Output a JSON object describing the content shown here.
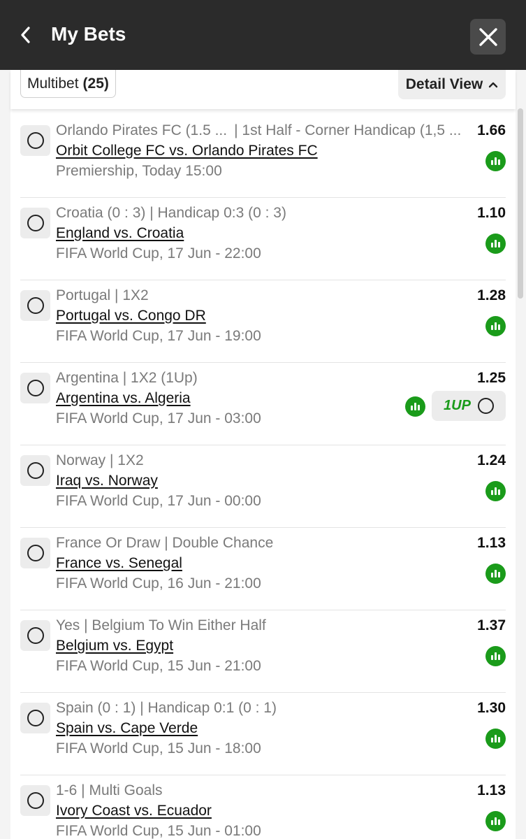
{
  "header": {
    "title": "My Bets"
  },
  "tabs": {
    "multibet_label": "Multibet",
    "multibet_count": "(25)",
    "detail_view_label": "Detail View"
  },
  "bets": [
    {
      "selection_left": "Orlando Pirates FC (1.5 ...",
      "selection_right": "| 1st Half - Corner Handicap (1,5 ...",
      "match": "Orbit College FC vs. Orlando Pirates FC",
      "info": "Premiership, Today 15:00",
      "odds": "1.66"
    },
    {
      "selection": "Croatia (0 : 3) | Handicap 0:3 (0 : 3)",
      "match": "England vs. Croatia",
      "info": "FIFA World Cup, 17 Jun - 22:00",
      "odds": "1.10"
    },
    {
      "selection": "Portugal | 1X2",
      "match": "Portugal vs. Congo DR",
      "info": "FIFA World Cup, 17 Jun - 19:00",
      "odds": "1.28"
    },
    {
      "selection": "Argentina | 1X2 (1Up)",
      "match": "Argentina vs. Algeria",
      "info": "FIFA World Cup, 17 Jun - 03:00",
      "odds": "1.25",
      "oneup": "1UP"
    },
    {
      "selection": "Norway | 1X2",
      "match": "Iraq vs. Norway",
      "info": "FIFA World Cup, 17 Jun - 00:00",
      "odds": "1.24"
    },
    {
      "selection": "France Or Draw | Double Chance",
      "match": "France vs. Senegal",
      "info": "FIFA World Cup, 16 Jun - 21:00",
      "odds": "1.13"
    },
    {
      "selection": "Yes | Belgium To Win Either Half",
      "match": "Belgium vs. Egypt",
      "info": "FIFA World Cup, 15 Jun - 21:00",
      "odds": "1.37"
    },
    {
      "selection": "Spain (0 : 1) | Handicap 0:1 (0 : 1)",
      "match": "Spain vs. Cape Verde",
      "info": "FIFA World Cup, 15 Jun - 18:00",
      "odds": "1.30"
    },
    {
      "selection": "1-6 | Multi Goals",
      "match": "Ivory Coast vs. Ecuador",
      "info": "FIFA World Cup, 15 Jun - 01:00",
      "odds": "1.13"
    }
  ],
  "colors": {
    "accent_green": "#1a9b1a",
    "header_bg": "#2b2b2b"
  },
  "icons": {
    "back": "chevron-left-icon",
    "close": "close-icon",
    "detail": "chevron-up-icon",
    "stats": "stats-icon",
    "select": "radio-icon"
  }
}
